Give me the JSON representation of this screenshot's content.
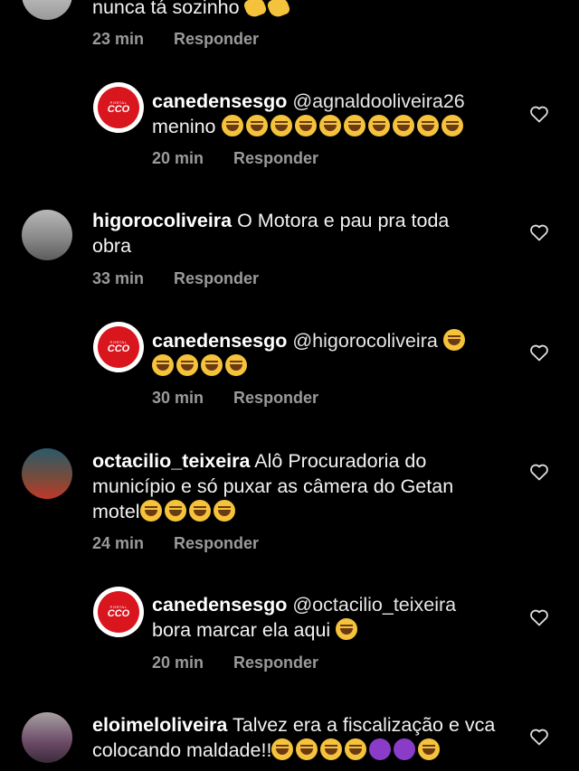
{
  "comments": [
    {
      "username": "",
      "body": "nunca tá sozinho",
      "time": "23 min",
      "reply": "Responder",
      "emoji": "clap"
    },
    {
      "username": "canedensesgo",
      "mention": "@agnaldooliveira26",
      "body": "menino",
      "time": "20 min",
      "reply": "Responder",
      "avatar_text": {
        "top": "PORTAL",
        "main": "CCO"
      },
      "emoji_count": 10
    },
    {
      "username": "higorocoliveira",
      "body": "O Motora e pau pra toda obra",
      "time": "33 min",
      "reply": "Responder"
    },
    {
      "username": "canedensesgo",
      "mention": "@higorocoliveira",
      "body": "",
      "time": "30 min",
      "reply": "Responder",
      "avatar_text": {
        "top": "PORTAL",
        "main": "CCO"
      },
      "emoji_count": 5
    },
    {
      "username": "octacilio_teixeira",
      "body": "Alô Procuradoria do município e só puxar as câmera do Getan motel",
      "time": "24 min",
      "reply": "Responder",
      "emoji_count": 4
    },
    {
      "username": "canedensesgo",
      "mention": "@octacilio_teixeira",
      "body": "bora marcar ela aqui",
      "time": "20 min",
      "reply": "Responder",
      "avatar_text": {
        "top": "PORTAL",
        "main": "CCO"
      },
      "emoji_count": 1
    },
    {
      "username": "eloimeloliveira",
      "body": "Talvez era a fiscalização e vca colocando maldade!!",
      "emoji_count": 5,
      "devil_count": 2
    }
  ],
  "colors": {
    "background": "#000000",
    "text": "#f2f2f2",
    "meta": "#9a9a9a",
    "brand_red": "#d9151d"
  },
  "icons": {
    "like": "heart-outline-icon"
  }
}
